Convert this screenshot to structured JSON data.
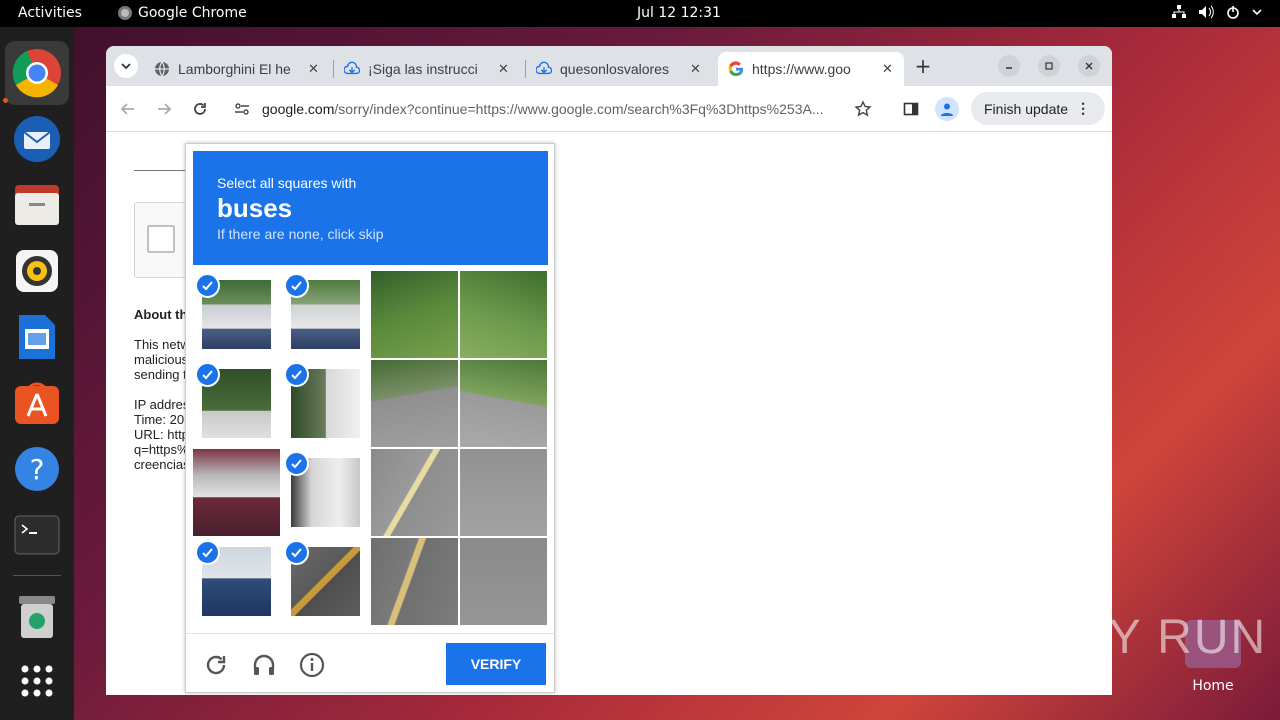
{
  "topbar": {
    "activities": "Activities",
    "app_name": "Google Chrome",
    "clock": "Jul 12  12:31"
  },
  "dock": {
    "items": [
      "chrome-icon",
      "thunderbird-icon",
      "files-icon",
      "rhythmbox-icon",
      "writer-icon",
      "app-center-icon",
      "help-icon",
      "terminal-icon",
      "trash-icon",
      "show-apps-icon"
    ]
  },
  "desktop": {
    "home_label": "Home",
    "watermark": "ANY RUN"
  },
  "browser": {
    "tabs": [
      {
        "title": "Lamborghini El he",
        "icon": "globe-icon"
      },
      {
        "title": "¡Siga las instrucci",
        "icon": "download-icon"
      },
      {
        "title": "quesonlosvalores",
        "icon": "download-icon"
      },
      {
        "title": "https://www.goo",
        "icon": "google-icon"
      }
    ],
    "url_host": "google.com",
    "url_rest": "/sorry/index?continue=https://www.google.com/search%3Fq%3Dhttps%253A...",
    "finish_update": "Finish update"
  },
  "page": {
    "heading": "About th",
    "para1": [
      "This netw",
      "malicious",
      "sending t"
    ],
    "para2": [
      "IP addres",
      "Time: 20",
      "URL: http",
      "q=https%",
      "creencias"
    ]
  },
  "captcha": {
    "prompt": "Select all squares with",
    "object": "buses",
    "hint": "If there are none, click skip",
    "verify": "VERIFY",
    "selected": [
      true,
      true,
      false,
      false,
      true,
      true,
      false,
      false,
      false,
      true,
      false,
      false,
      true,
      true,
      false,
      false
    ]
  },
  "colors": {
    "accent": "#1a73e8",
    "ubuntu_orange": "#e95420"
  }
}
